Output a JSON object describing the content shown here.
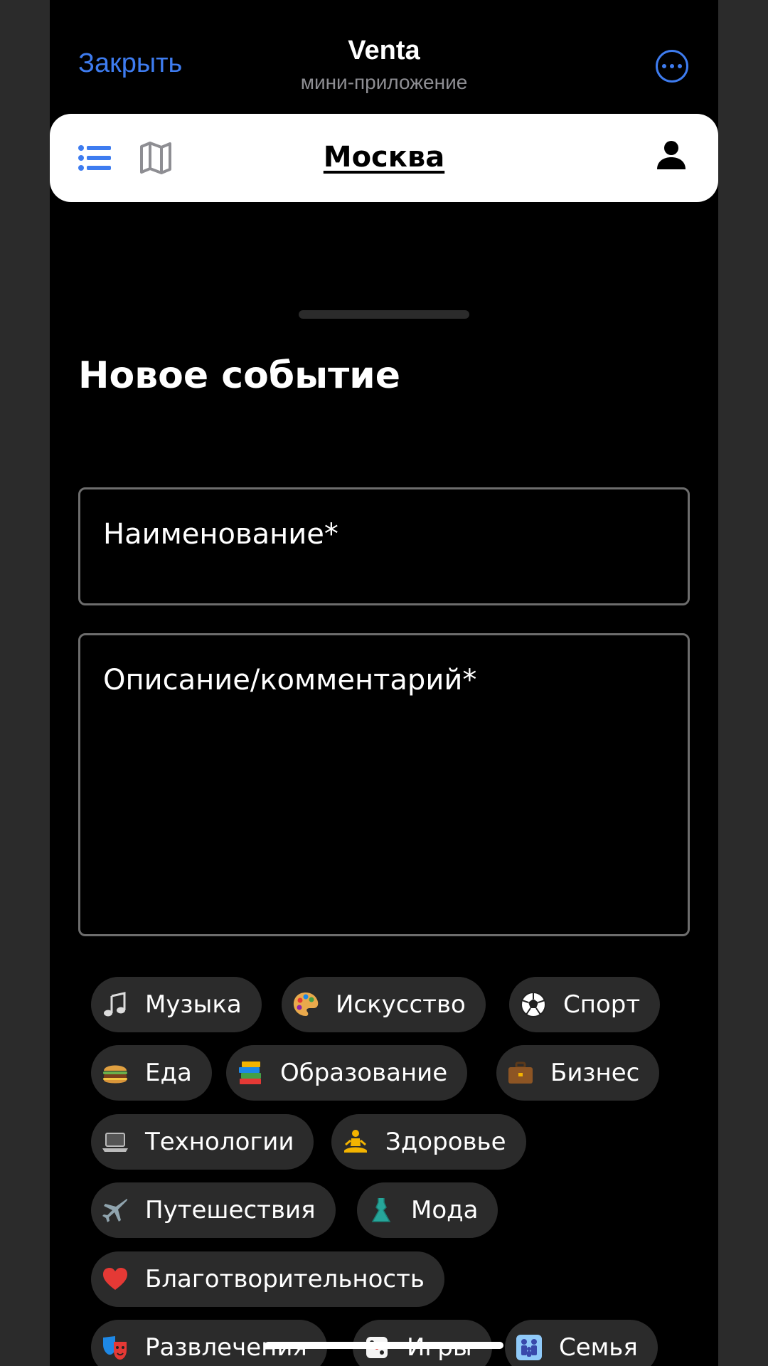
{
  "header": {
    "close_label": "Закрыть",
    "title": "Venta",
    "subtitle": "мини-приложение"
  },
  "navbar": {
    "city": "Москва"
  },
  "form": {
    "title": "Новое событие",
    "name_placeholder": "Наименование*",
    "description_placeholder": "Описание/комментарий*"
  },
  "categories": [
    {
      "label": "Музыка",
      "icon": "music-note-icon"
    },
    {
      "label": "Искусство",
      "icon": "palette-icon"
    },
    {
      "label": "Спорт",
      "icon": "soccer-ball-icon"
    },
    {
      "label": "Еда",
      "icon": "burger-icon"
    },
    {
      "label": "Образование",
      "icon": "books-icon"
    },
    {
      "label": "Бизнес",
      "icon": "briefcase-icon"
    },
    {
      "label": "Технологии",
      "icon": "laptop-icon"
    },
    {
      "label": "Здоровье",
      "icon": "meditation-icon"
    },
    {
      "label": "Путешествия",
      "icon": "airplane-icon"
    },
    {
      "label": "Мода",
      "icon": "dress-icon"
    },
    {
      "label": "Благотворительность",
      "icon": "heart-icon"
    },
    {
      "label": "Развлечения",
      "icon": "theater-masks-icon"
    },
    {
      "label": "Игры",
      "icon": "dice-icon"
    },
    {
      "label": "Семья",
      "icon": "family-icon"
    }
  ],
  "colors": {
    "accent": "#3e7cf0",
    "chip_bg": "#2b2b2b",
    "background": "#000000",
    "navbar": "#ffffff"
  }
}
